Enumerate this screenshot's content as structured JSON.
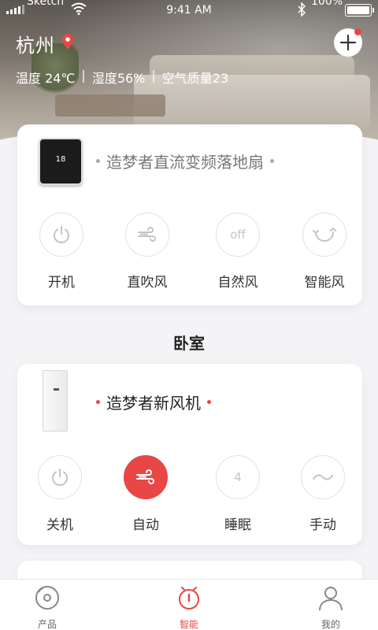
{
  "status_bar": {
    "carrier": "Sketch",
    "time": "9:41 AM",
    "battery": "100%"
  },
  "header": {
    "city": "杭州",
    "weather": {
      "temperature": "温度 24℃",
      "humidity": "湿度56%",
      "air_quality": "空气质量23"
    }
  },
  "device_cards": [
    {
      "title": "造梦者直流变频落地扇",
      "display_value": "18",
      "controls": [
        {
          "label": "开机",
          "icon": "power-icon",
          "active": false
        },
        {
          "label": "直吹风",
          "icon": "wind-icon",
          "active": false
        },
        {
          "label": "自然风",
          "icon": "off-text-icon",
          "icon_text": "off",
          "active": false
        },
        {
          "label": "智能风",
          "icon": "cycle-icon",
          "active": false
        }
      ]
    },
    {
      "title": "造梦者新风机",
      "controls": [
        {
          "label": "关机",
          "icon": "power-icon",
          "active": false
        },
        {
          "label": "自动",
          "icon": "wind-icon",
          "active": true
        },
        {
          "label": "睡眠",
          "icon": "number-icon",
          "icon_text": "4",
          "active": false
        },
        {
          "label": "手动",
          "icon": "wave-icon",
          "active": false
        }
      ]
    }
  ],
  "section": {
    "title": "卧室"
  },
  "tab_bar": [
    {
      "label": "产品",
      "icon": "product-icon",
      "active": false
    },
    {
      "label": "智能",
      "icon": "smart-icon",
      "active": true
    },
    {
      "label": "我的",
      "icon": "profile-icon",
      "active": false
    }
  ],
  "colors": {
    "accent": "#e94646",
    "background": "#f4f4f6",
    "card": "#ffffff"
  }
}
